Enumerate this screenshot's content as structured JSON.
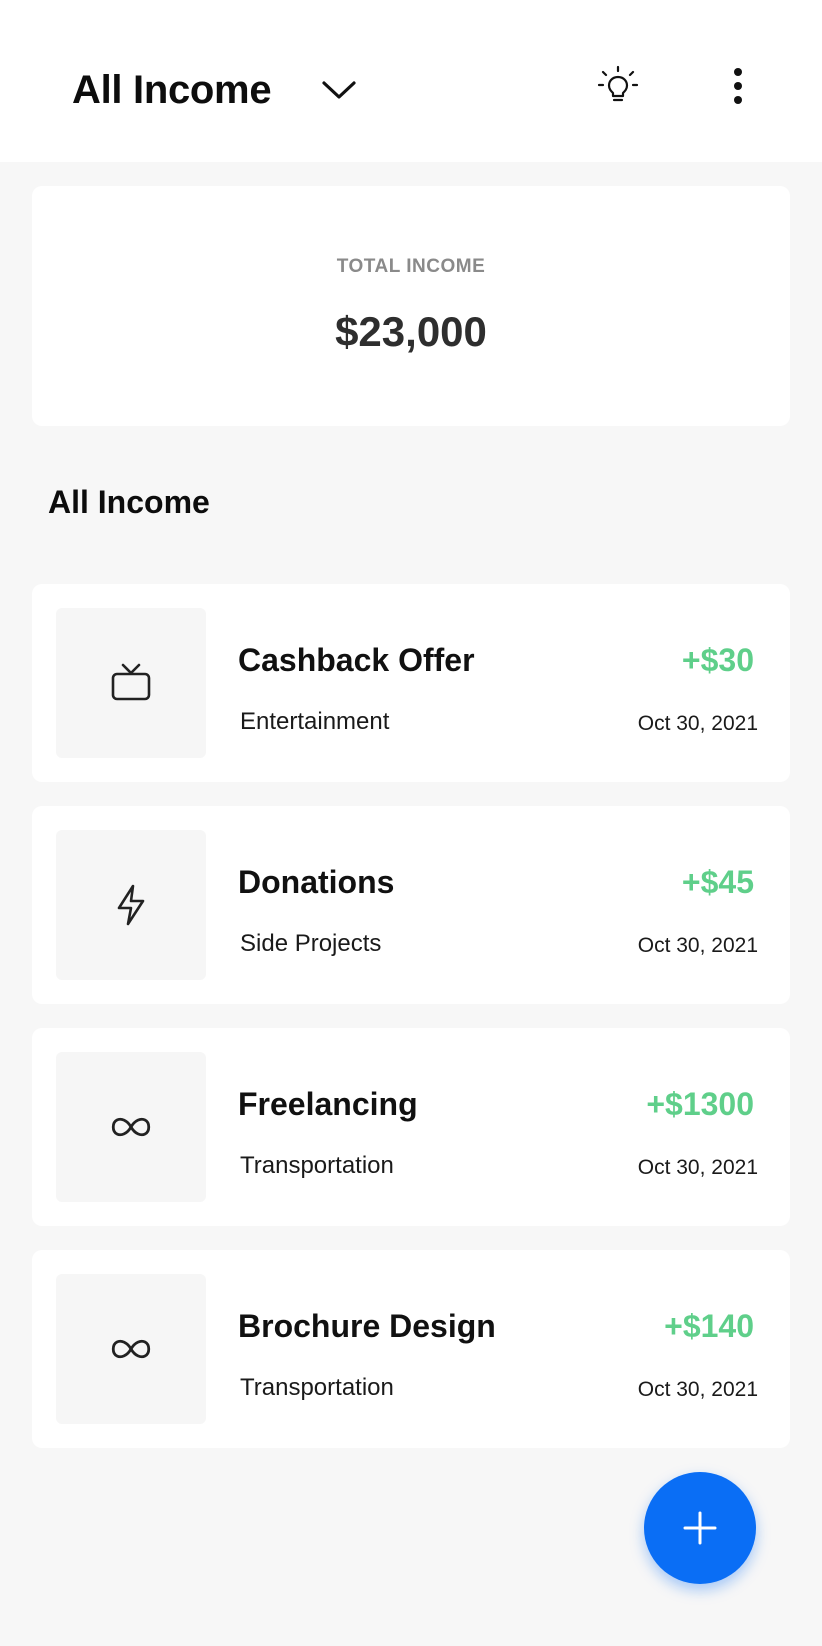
{
  "header": {
    "title": "All Income",
    "icons": {
      "dropdown": "chevron-down-icon",
      "tips": "lightbulb-icon",
      "menu": "more-vertical-icon"
    }
  },
  "summary": {
    "label": "TOTAL INCOME",
    "value": "$23,000"
  },
  "list": {
    "title": "All Income",
    "items": [
      {
        "name": "Cashback Offer",
        "category": "Entertainment",
        "amount": "+$30",
        "date": "Oct 30, 2021",
        "icon": "tv-icon"
      },
      {
        "name": "Donations",
        "category": "Side Projects",
        "amount": "+$45",
        "date": "Oct 30, 2021",
        "icon": "lightning-icon"
      },
      {
        "name": "Freelancing",
        "category": "Transportation",
        "amount": "+$1300",
        "date": "Oct 30, 2021",
        "icon": "infinity-icon"
      },
      {
        "name": "Brochure Design",
        "category": "Transportation",
        "amount": "+$140",
        "date": "Oct 30, 2021",
        "icon": "infinity-icon"
      }
    ]
  },
  "fab": {
    "icon": "plus-icon"
  },
  "colors": {
    "accent": "#0a6ef5",
    "income_amount": "#5fcf8a",
    "muted_label": "#8a8a8a",
    "page_bg": "#f7f7f7",
    "card_bg": "#ffffff"
  }
}
